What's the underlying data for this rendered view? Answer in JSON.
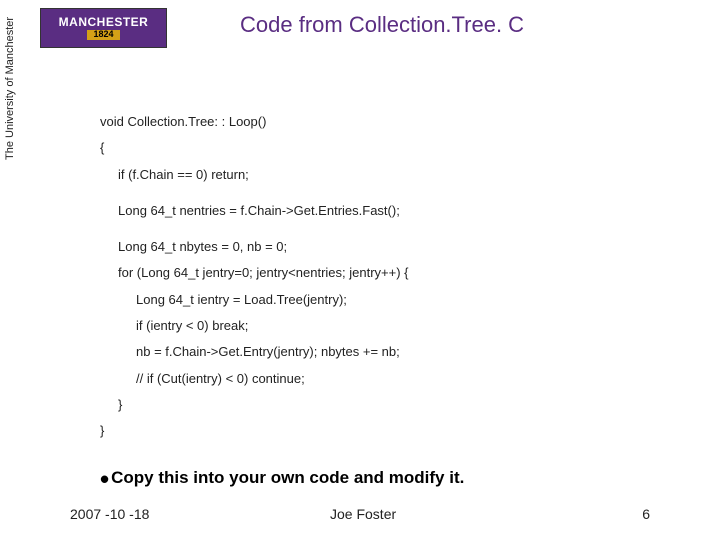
{
  "logo": {
    "name": "MANCHESTER",
    "year": "1824",
    "side": "The University of Manchester"
  },
  "title": "Code from Collection.Tree. C",
  "code": {
    "l1": "void Collection.Tree: : Loop()",
    "l2": "{",
    "l3": "if (f.Chain == 0) return;",
    "l4": "Long 64_t nentries = f.Chain->Get.Entries.Fast();",
    "l5": "Long 64_t nbytes = 0, nb = 0;",
    "l6": "for (Long 64_t jentry=0; jentry<nentries; jentry++) {",
    "l7": "Long 64_t ientry = Load.Tree(jentry);",
    "l8": "if (ientry < 0) break;",
    "l9": "nb = f.Chain->Get.Entry(jentry);   nbytes += nb;",
    "l10": "// if (Cut(ientry) < 0) continue;",
    "l11": "}",
    "l12": "}"
  },
  "note": "Copy this into your own code and modify it.",
  "footer": {
    "date": "2007 -10 -18",
    "author": "Joe Foster",
    "page": "6"
  }
}
